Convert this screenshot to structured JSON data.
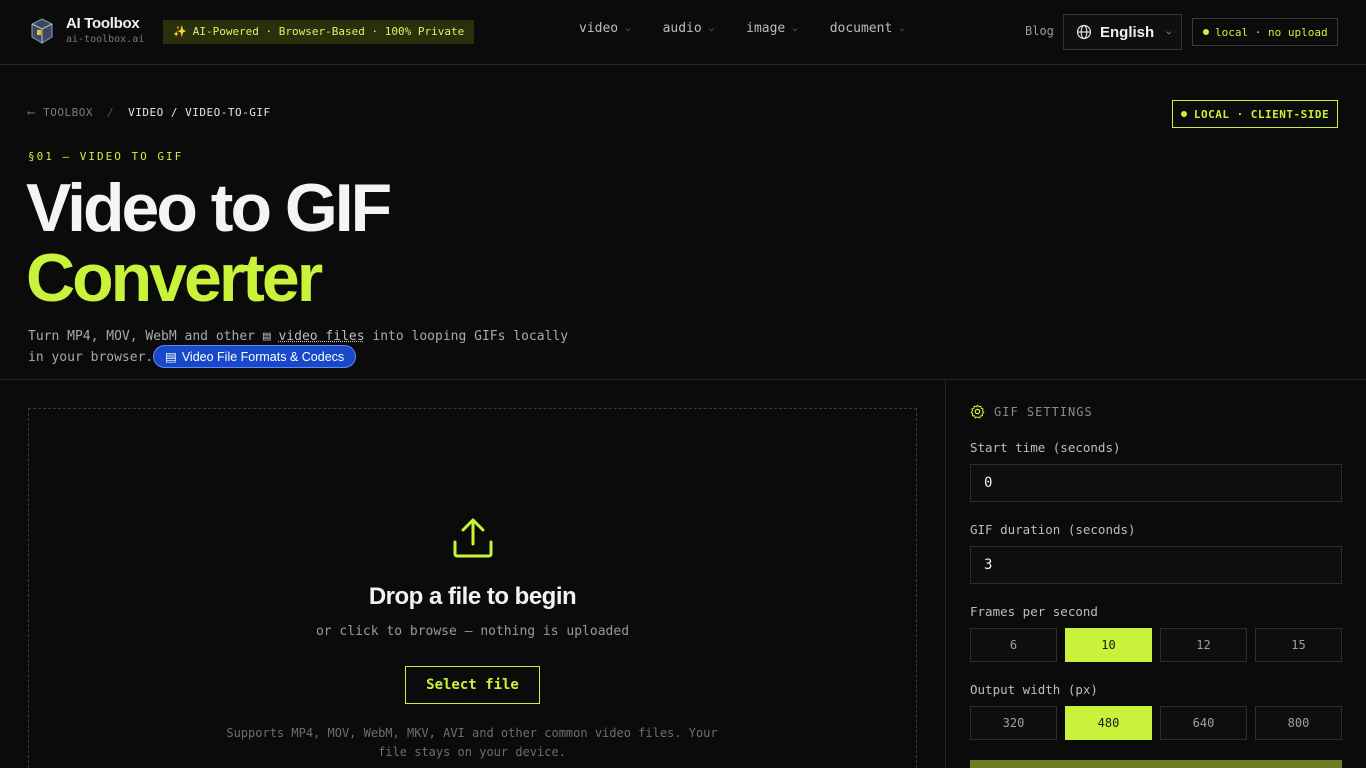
{
  "header": {
    "brand_name": "AI Toolbox",
    "brand_domain": "ai-toolbox.ai",
    "promo": "AI-Powered · Browser-Based · 100% Private",
    "nav": [
      {
        "label": "video"
      },
      {
        "label": "audio"
      },
      {
        "label": "image"
      },
      {
        "label": "document"
      }
    ],
    "blog": "Blog",
    "language": "English",
    "privacy_badge": "local · no upload"
  },
  "hero": {
    "breadcrumb_back": "TOOLBOX",
    "breadcrumb_sep": "/",
    "breadcrumb_current": "VIDEO / VIDEO-TO-GIF",
    "client_badge": "LOCAL · CLIENT-SIDE",
    "section_label": "§01 — VIDEO TO GIF",
    "title_line1": "Video to GIF",
    "title_line2": "Converter",
    "desc_before": "Turn MP4, MOV, WebM and other ",
    "desc_link": "video files",
    "desc_after": " into looping GIFs locally in your browser.",
    "formats_chip": "Video File Formats & Codecs"
  },
  "dropzone": {
    "title": "Drop a file to begin",
    "subtitle": "or click to browse — nothing is uploaded",
    "button": "Select file",
    "supports": "Supports MP4, MOV, WebM, MKV, AVI and other common video files. Your file stays on your device."
  },
  "settings": {
    "heading": "GIF SETTINGS",
    "start_label": "Start time (seconds)",
    "start_value": "0",
    "duration_label": "GIF duration (seconds)",
    "duration_value": "3",
    "fps_label": "Frames per second",
    "fps_options": [
      "6",
      "10",
      "12",
      "15"
    ],
    "fps_selected": "10",
    "width_label": "Output width (px)",
    "width_options": [
      "320",
      "480",
      "640",
      "800"
    ],
    "width_selected": "480"
  },
  "colors": {
    "accent": "#c9f23a",
    "background": "#0b0b0b",
    "chip_blue": "#1749c9"
  }
}
